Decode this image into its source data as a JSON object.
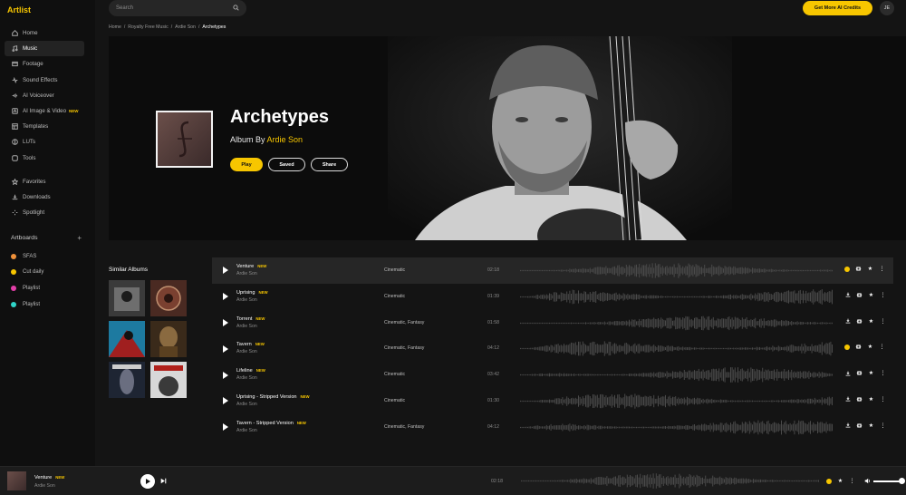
{
  "app": {
    "logo": "Artlist"
  },
  "sidebar": {
    "items": [
      {
        "label": "Home",
        "icon": "home-icon",
        "active": false,
        "new": ""
      },
      {
        "label": "Music",
        "icon": "music-icon",
        "active": true,
        "new": ""
      },
      {
        "label": "Footage",
        "icon": "film-icon",
        "active": false,
        "new": ""
      },
      {
        "label": "Sound Effects",
        "icon": "sound-icon",
        "active": false,
        "new": ""
      },
      {
        "label": "AI Voiceover",
        "icon": "voice-icon",
        "active": false,
        "new": ""
      },
      {
        "label": "AI Image & Video",
        "icon": "ai-icon",
        "active": false,
        "new": "NEW"
      },
      {
        "label": "Templates",
        "icon": "template-icon",
        "active": false,
        "new": ""
      },
      {
        "label": "LUTs",
        "icon": "lut-icon",
        "active": false,
        "new": ""
      },
      {
        "label": "Tools",
        "icon": "tools-icon",
        "active": false,
        "new": ""
      }
    ],
    "secondary": [
      {
        "label": "Favorites",
        "icon": "star-icon"
      },
      {
        "label": "Downloads",
        "icon": "download-icon"
      },
      {
        "label": "Spotlight",
        "icon": "spotlight-icon"
      }
    ],
    "artboards_title": "Artboards",
    "artboards": [
      {
        "label": "SFAS",
        "color": "#f0913a"
      },
      {
        "label": "Cut daily",
        "color": "#f7c600"
      },
      {
        "label": "Playlist",
        "color": "#e33fa8"
      },
      {
        "label": "Playlist",
        "color": "#2fd4c8"
      }
    ]
  },
  "topbar": {
    "search_placeholder": "Search",
    "credits_button": "Get More AI Credits",
    "user_initials": "JE"
  },
  "breadcrumb": [
    "Home",
    "/",
    "Royalty Free Music",
    "/",
    "Ardie Son",
    "/",
    "Archetypes"
  ],
  "album": {
    "title": "Archetypes",
    "by_label": "Album By",
    "artist": "Ardie Son",
    "play": "Play",
    "saved": "Saved",
    "share": "Share"
  },
  "similar": {
    "title": "Similar Albums",
    "count": 6
  },
  "tracks": [
    {
      "name": "Venture",
      "new": "NEW",
      "artist": "Ardie Son",
      "genre": "Cinematic",
      "duration": "02:18",
      "active": true,
      "coin": true
    },
    {
      "name": "Uprising",
      "new": "NEW",
      "artist": "Ardie Son",
      "genre": "Cinematic",
      "duration": "01:39",
      "active": false,
      "coin": false
    },
    {
      "name": "Torrent",
      "new": "NEW",
      "artist": "Ardie Son",
      "genre": "Cinematic, Fantasy",
      "duration": "01:58",
      "active": false,
      "coin": false
    },
    {
      "name": "Tavern",
      "new": "NEW",
      "artist": "Ardie Son",
      "genre": "Cinematic, Fantasy",
      "duration": "04:12",
      "active": false,
      "coin": true
    },
    {
      "name": "Lifeline",
      "new": "NEW",
      "artist": "Ardie Son",
      "genre": "Cinematic",
      "duration": "03:42",
      "active": false,
      "coin": false
    },
    {
      "name": "Uprising - Stripped Version",
      "new": "NEW",
      "artist": "Ardie Son",
      "genre": "Cinematic",
      "duration": "01:30",
      "active": false,
      "coin": false
    },
    {
      "name": "Tavern - Stripped Version",
      "new": "NEW",
      "artist": "Ardie Son",
      "genre": "Cinematic, Fantasy",
      "duration": "04:12",
      "active": false,
      "coin": false
    }
  ],
  "player": {
    "name": "Venture",
    "new": "NEW",
    "artist": "Ardie Son",
    "time": "02:18",
    "volume": 1.0
  }
}
